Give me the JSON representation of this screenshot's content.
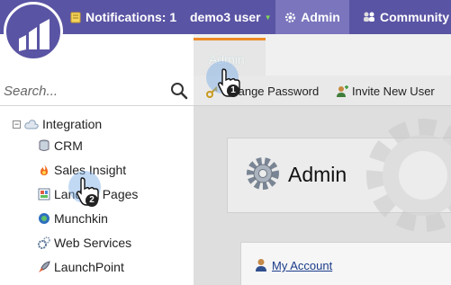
{
  "topbar": {
    "notifications_label": "Notifications: 1",
    "user_label": "demo3 user",
    "admin_label": "Admin",
    "community_label": "Community",
    "colors": {
      "bar": "#5a54a4",
      "active": "#7a75bd"
    }
  },
  "search": {
    "placeholder": "Search..."
  },
  "tree": {
    "root_label": "Integration",
    "items": [
      {
        "label": "CRM",
        "icon": "database-icon"
      },
      {
        "label": "Sales Insight",
        "icon": "flame-icon"
      },
      {
        "label": "Landing Pages",
        "icon": "landing-page-icon"
      },
      {
        "label": "Munchkin",
        "icon": "munchkin-icon"
      },
      {
        "label": "Web Services",
        "icon": "web-services-icon"
      },
      {
        "label": "LaunchPoint",
        "icon": "rocket-icon"
      }
    ]
  },
  "tabs": {
    "active_label": "Admin"
  },
  "toolbar": {
    "change_password": "Change Password",
    "invite_user": "Invite New User"
  },
  "main": {
    "title": "Admin",
    "my_account": "My Account"
  },
  "cursors": [
    {
      "step": "1"
    },
    {
      "step": "2"
    }
  ]
}
